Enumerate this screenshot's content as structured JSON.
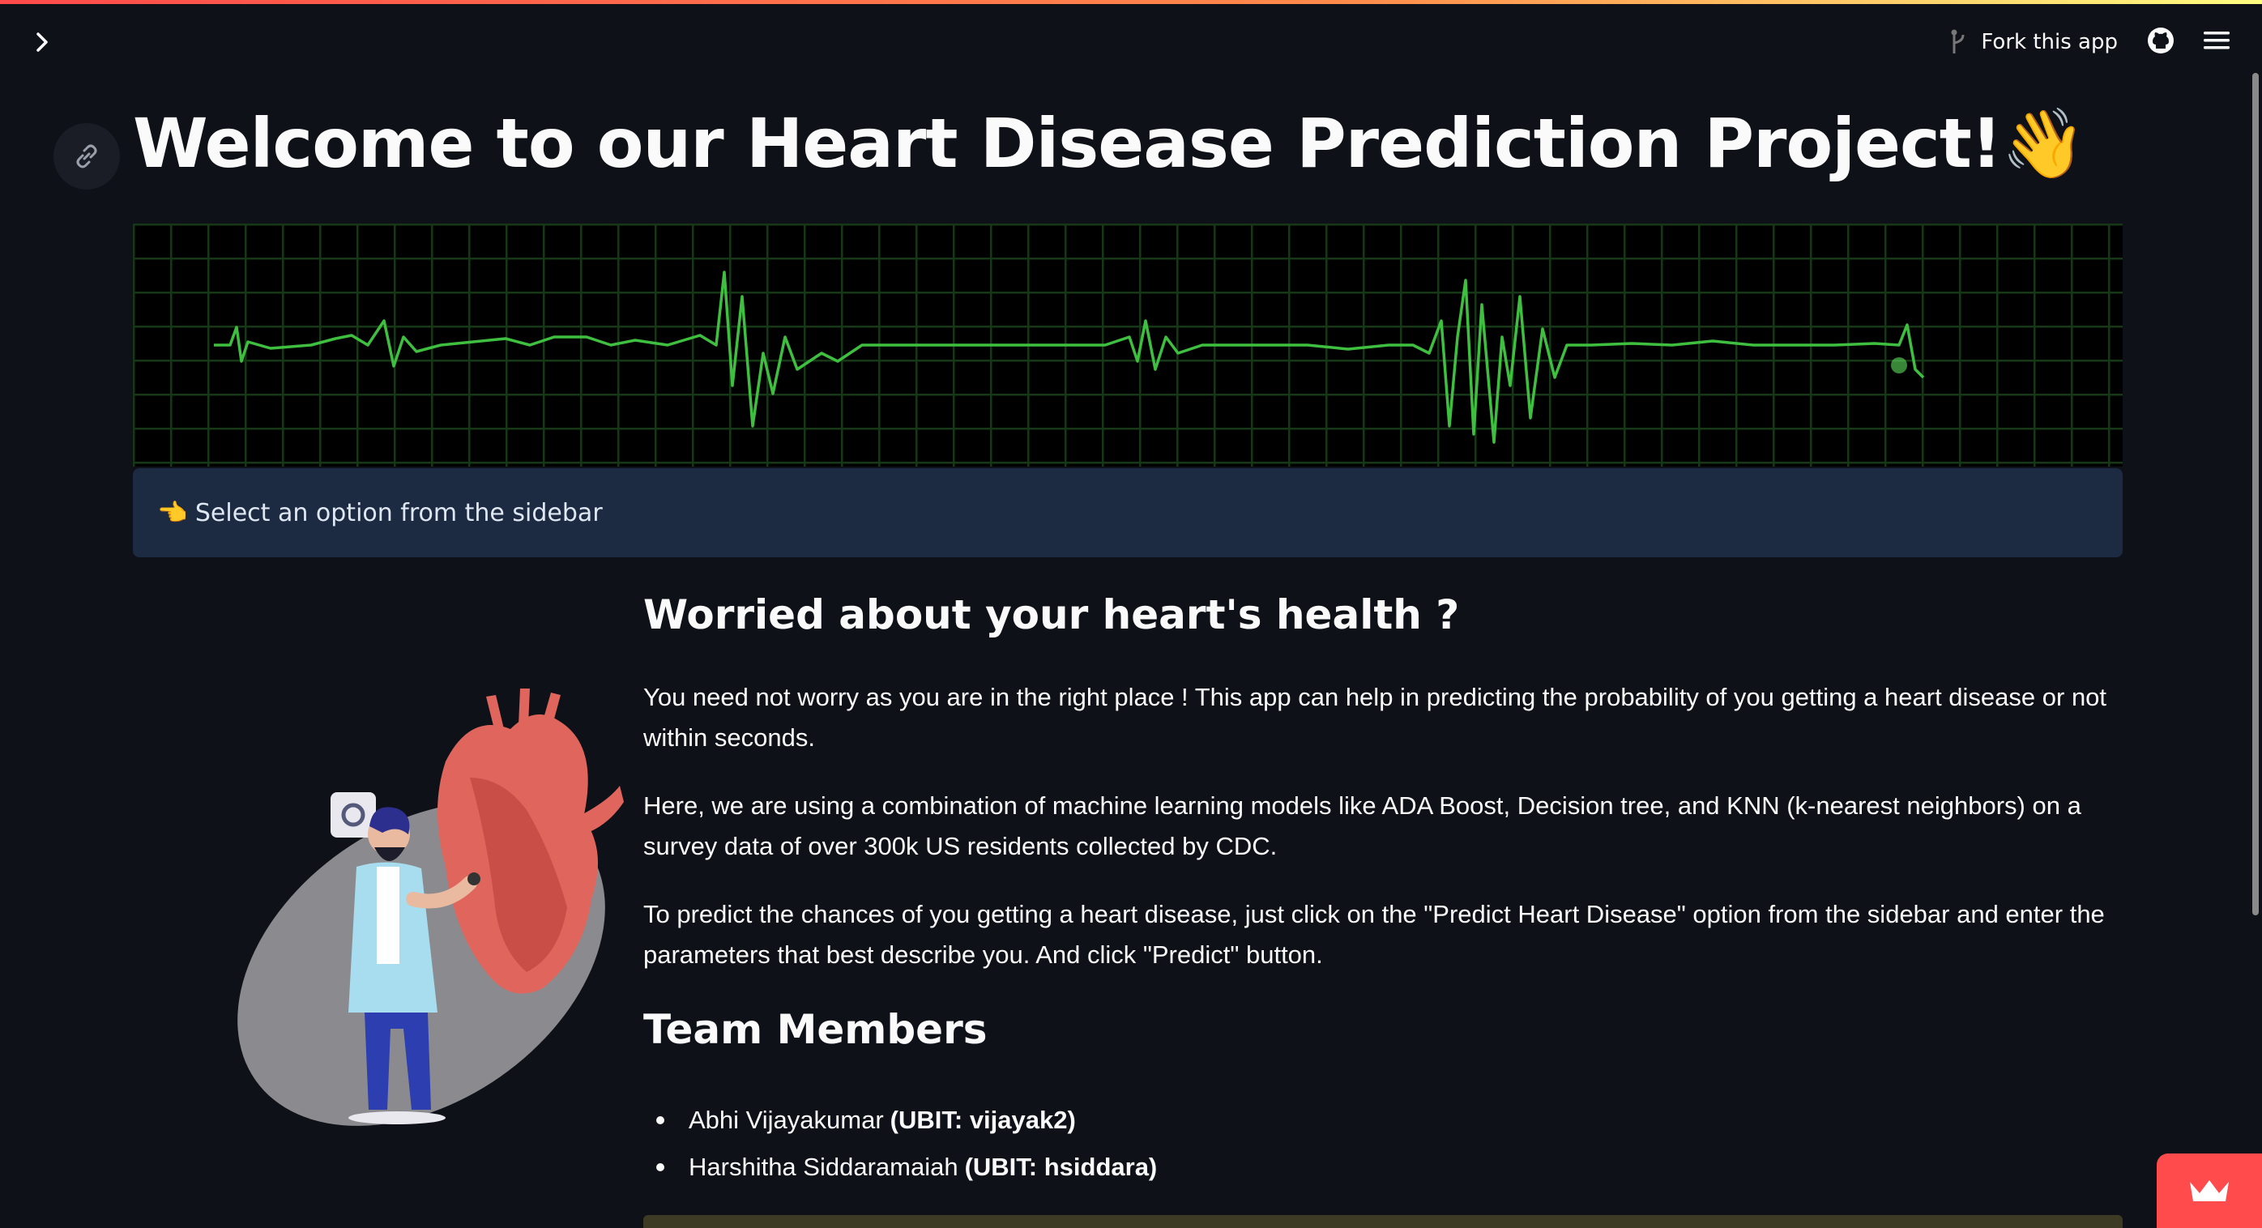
{
  "header": {
    "fork_label": "Fork this app",
    "icons": [
      "chevron-right-icon",
      "fork-icon",
      "github-icon",
      "hamburger-menu-icon"
    ],
    "accent_gradient": [
      "#ff4b4b",
      "#ff8c4b",
      "#fffd80"
    ]
  },
  "main": {
    "title": "Welcome to our Heart Disease Prediction Project!👋",
    "info_text": "👈 Select an option from the sidebar",
    "section_heading": "Worried about your heart's health ?",
    "paragraphs": [
      "You need not worry as you are in the right place ! This app can help in predicting the probability of you getting a heart disease or not within seconds.",
      "Here, we are using a combination of machine learning models like ADA Boost, Decision tree, and KNN (k-nearest neighbors) on a survey data of over 300k US residents collected by CDC.",
      "To predict the chances of you getting a heart disease, just click on the \"Predict Heart Disease\" option from the sidebar and enter the parameters that best describe you. And click \"Predict\" button."
    ],
    "team_heading": "Team Members",
    "team": [
      {
        "name": "Abhi Vijayakumar",
        "ubit": "(UBIT: vijayak2)"
      },
      {
        "name": "Harshitha Siddaramaiah",
        "ubit": "(UBIT: hsiddara)"
      }
    ]
  },
  "colors": {
    "background": "#0e1117",
    "info_box": "#1c2b42",
    "ecg_line": "#3fbf3f",
    "badge": "#ff4b4b"
  }
}
